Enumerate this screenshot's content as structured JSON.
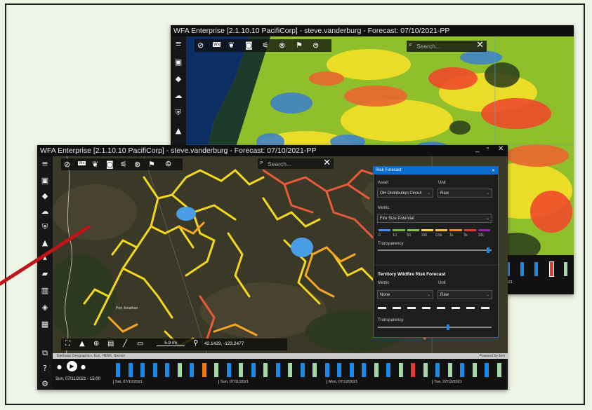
{
  "back_window": {
    "title": "WFA Enterprise [2.1.10.10 PacifiCorp] - steve.vanderburg - Forecast: 07/10/2021-PP",
    "search_placeholder": "Search...",
    "sidebar_icons": [
      "menu-icon",
      "calendar-icon",
      "route-icon",
      "cloud-icon",
      "shield-icon",
      "warning-icon"
    ],
    "toolbar_icons": [
      "no-vehicle-icon",
      "wx-icon",
      "leaf-icon",
      "camera-icon",
      "satellite-icon",
      "no-entry-icon",
      "people-icon",
      "cable-icon"
    ],
    "wx_label": "Wx",
    "timeline_date": "2021"
  },
  "front_window": {
    "title": "WFA Enterprise [2.1.10.10 PacifiCorp] - steve.vanderburg - Forecast: 07/10/2021-PP",
    "window_controls": [
      "_",
      "▫",
      "✕"
    ],
    "search_placeholder": "Search...",
    "toolbar_icons": [
      "no-vehicle-icon",
      "wx-icon",
      "leaf-icon",
      "camera-icon",
      "satellite-icon",
      "no-entry-icon",
      "people-icon",
      "cable-icon"
    ],
    "wx_label": "Wx",
    "sidebar_icons": [
      "menu-icon",
      "calendar-icon",
      "route-icon",
      "cloud-icon",
      "shield-icon",
      "warning-icon",
      "fire-icon",
      "folder-icon",
      "chart-icon",
      "layers-icon",
      "grid-icon"
    ],
    "sidebar_bottom_icons": [
      "windows-icon",
      "help-icon",
      "settings-icon"
    ],
    "map_tools": {
      "scale": "5.9 mi",
      "coordinates": "42.1429, -123.2477"
    },
    "attribution": "Earthstar Geographics, Esri, HERE, Garmin",
    "powered_by": "Powered by Esri",
    "place_label": "Port Jonathan",
    "timeline": {
      "current_time": "Sun, 07/11/2021 - 15:00",
      "dates": [
        "Sat, 07/10/2021",
        "Sun, 07/11/2021",
        "Mon, 07/12/2021",
        "Tue, 07/13/2021"
      ],
      "bar_colors": [
        "#1e88e5",
        "#1e88e5",
        "#1e88e5",
        "#1e88e5",
        "#1e88e5",
        "#a5d6a7",
        "#1e88e5",
        "#f57c00",
        "#a5d6a7",
        "#1e88e5",
        "#a5d6a7",
        "#1e88e5",
        "#a5d6a7",
        "#1e88e5",
        "#a5d6a7",
        "#1e88e5",
        "#a5d6a7",
        "#1e88e5",
        "#1e88e5",
        "#1e88e5",
        "#1e88e5",
        "#a5d6a7",
        "#1e88e5",
        "#a5d6a7",
        "#e53935",
        "#a5d6a7",
        "#1e88e5",
        "#a5d6a7",
        "#1e88e5",
        "#a5d6a7",
        "#1e88e5",
        "#a5d6a7"
      ]
    }
  },
  "risk_panel": {
    "title": "Risk Forecast",
    "asset_label": "Asset",
    "asset_value": "OH Distribution Circuit",
    "unit_label": "Unit",
    "unit_value": "Raw",
    "metric_label": "Metric",
    "metric_value": "Fire Size Potential",
    "legend_ticks": [
      "0",
      "10",
      "50",
      "100",
      "0.5k",
      "1k",
      "5k",
      "10k"
    ],
    "legend_colors": [
      "#4a90e2",
      "#7cb342",
      "#8bc34a",
      "#fdd835",
      "#fbc02d",
      "#fb8c00",
      "#e53935",
      "#8e24aa"
    ],
    "transparency_label": "Transparency",
    "transparency_level": 0.98,
    "territory_title": "Territory Wildfire Risk Forecast",
    "t_metric_label": "Metric",
    "t_metric_value": "None",
    "t_unit_label": "Unit",
    "t_unit_value": "Raw",
    "t_transparency_label": "Transparency",
    "t_transparency_level": 0.62
  }
}
